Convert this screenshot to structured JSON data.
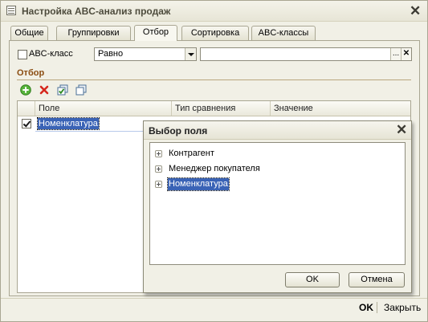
{
  "window": {
    "title": "Настройка ABC-анализ продаж",
    "close_icon": "✕"
  },
  "tabs": [
    {
      "label": "Общие",
      "active": false
    },
    {
      "label": "Группировки",
      "active": false
    },
    {
      "label": "Отбор",
      "active": true
    },
    {
      "label": "Сортировка",
      "active": false
    },
    {
      "label": "ABC-классы",
      "active": false
    }
  ],
  "abc_filter": {
    "label": "ABC-класс",
    "checked": false,
    "comparison_value": "Равно",
    "value": "",
    "ellipsis": "...",
    "clear": "✕"
  },
  "filter_section": {
    "title": "Отбор"
  },
  "toolbar": {
    "icons": [
      "add-icon",
      "delete-icon",
      "check-all-icon",
      "copy-icon"
    ]
  },
  "grid": {
    "columns": [
      "Поле",
      "Тип сравнения",
      "Значение"
    ],
    "rows": [
      {
        "checked": true,
        "field": "Номенклатура",
        "comparison": "",
        "value": ""
      }
    ]
  },
  "dialog": {
    "title": "Выбор поля",
    "close_icon": "✕",
    "items": [
      {
        "label": "Контрагент",
        "selected": false
      },
      {
        "label": "Менеджер покупателя",
        "selected": false
      },
      {
        "label": "Номенклатура",
        "selected": true
      }
    ],
    "ok_label": "OK",
    "cancel_label": "Отмена"
  },
  "footer": {
    "ok_label": "OK",
    "close_label": "Закрыть"
  },
  "colors": {
    "accent": "#3a63b6",
    "section_title": "#8a4b10",
    "window_bg": "#f1f0e6"
  }
}
